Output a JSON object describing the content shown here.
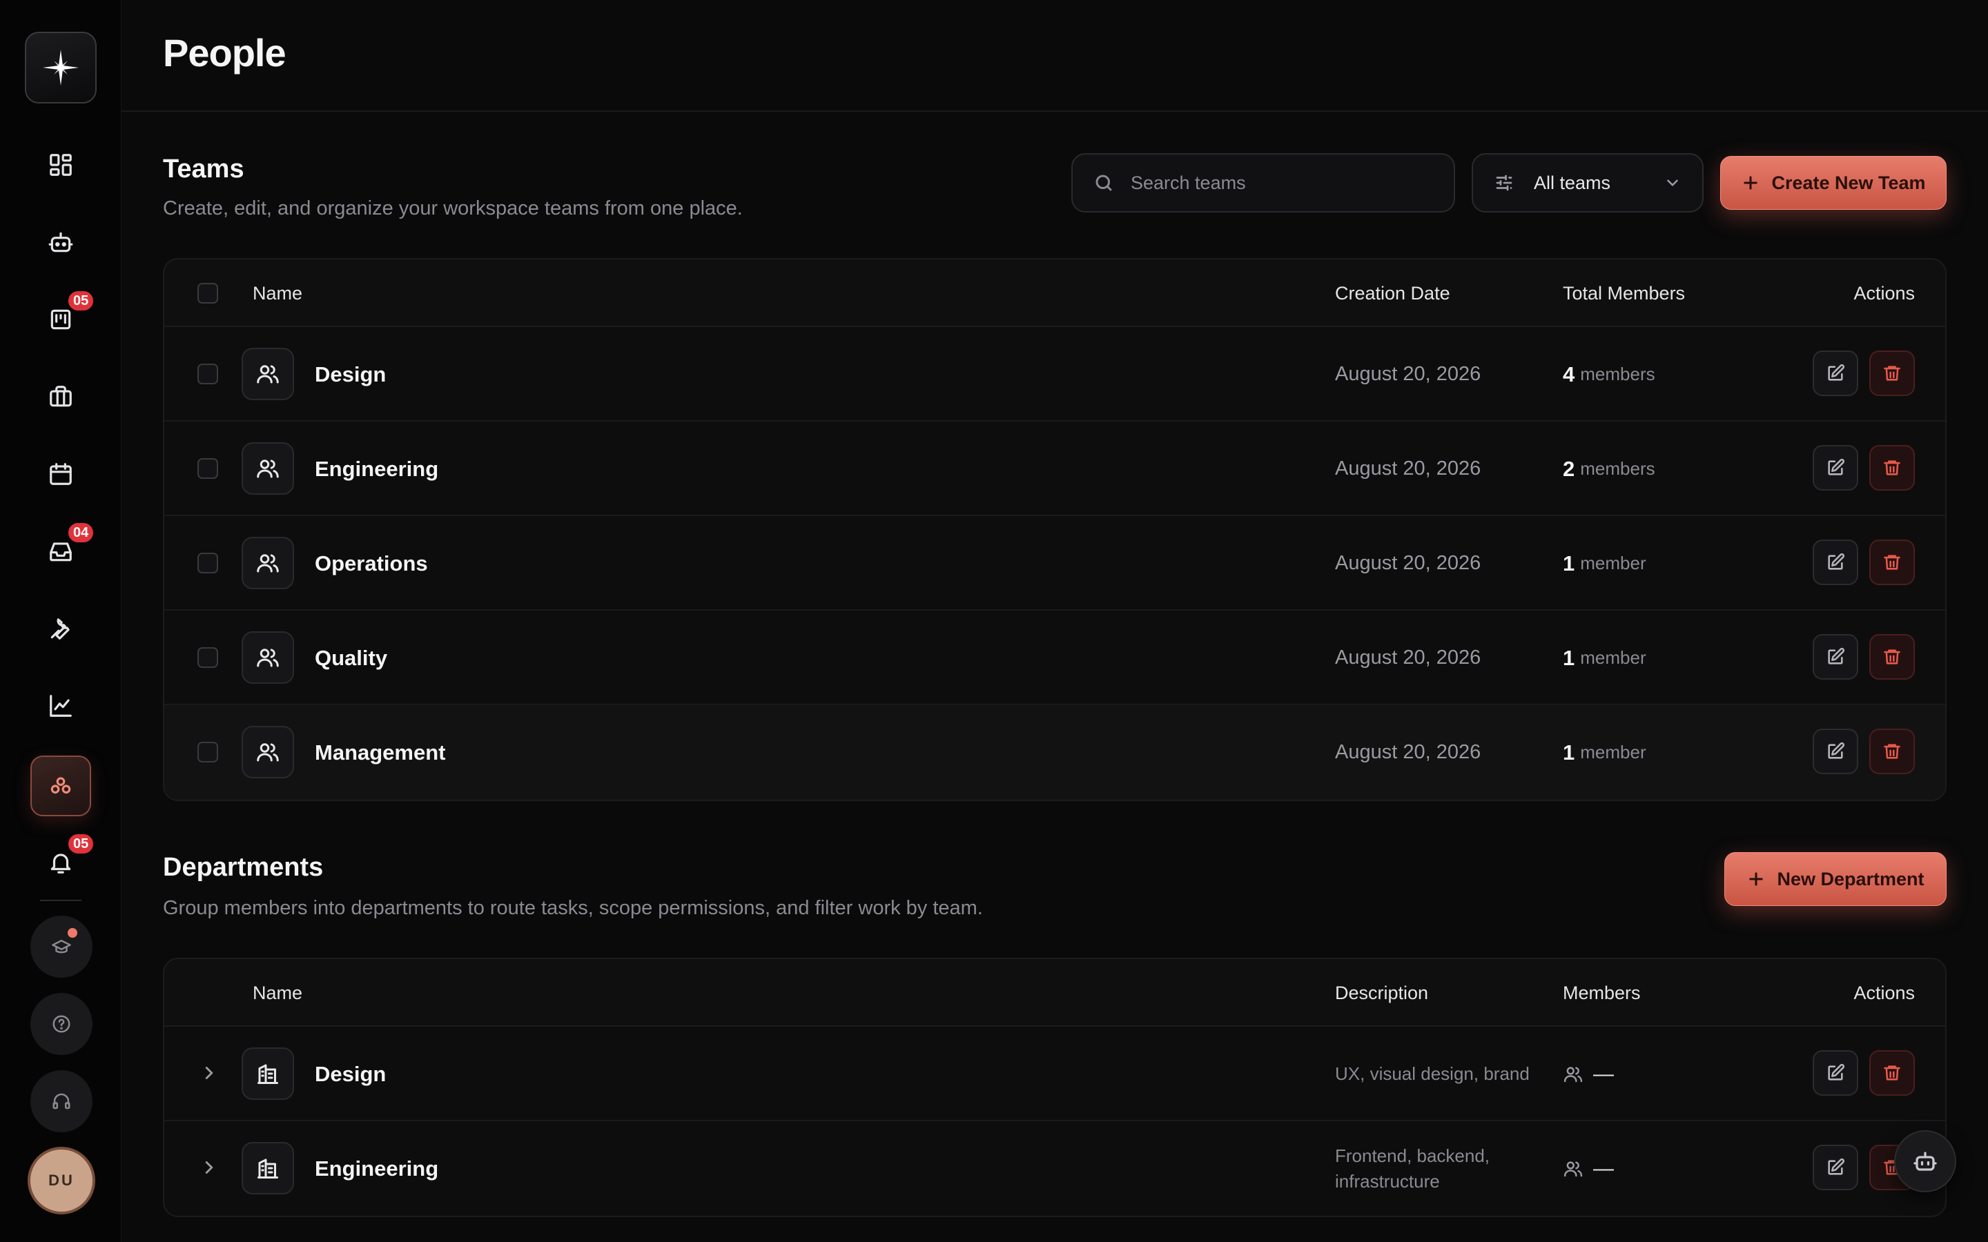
{
  "app": {
    "page_title": "People"
  },
  "sidebar": {
    "items": [
      {
        "icon": "dashboard-icon"
      },
      {
        "icon": "bot-icon"
      },
      {
        "icon": "board-icon",
        "badge": "05"
      },
      {
        "icon": "briefcase-icon"
      },
      {
        "icon": "calendar-icon"
      },
      {
        "icon": "inbox-icon",
        "badge": "04"
      },
      {
        "icon": "wrench-icon"
      },
      {
        "icon": "chart-icon"
      },
      {
        "icon": "people-icon",
        "active": true
      },
      {
        "icon": "bell-icon",
        "badge": "05"
      }
    ],
    "bottom": [
      {
        "icon": "graduation-cap-icon"
      },
      {
        "icon": "help-icon"
      },
      {
        "icon": "headset-icon"
      }
    ],
    "avatar_initials": "DU"
  },
  "teams": {
    "title": "Teams",
    "subtitle": "Create, edit, and organize your workspace teams from one place.",
    "search": {
      "placeholder": "Search teams"
    },
    "filter": {
      "selected": "All teams"
    },
    "create_button": "Create New Team",
    "columns": {
      "name": "Name",
      "date": "Creation Date",
      "members": "Total Members",
      "actions": "Actions"
    },
    "rows": [
      {
        "name": "Design",
        "date": "August 20, 2026",
        "count": "4",
        "unit": "members"
      },
      {
        "name": "Engineering",
        "date": "August 20, 2026",
        "count": "2",
        "unit": "members"
      },
      {
        "name": "Operations",
        "date": "August 20, 2026",
        "count": "1",
        "unit": "member"
      },
      {
        "name": "Quality",
        "date": "August 20, 2026",
        "count": "1",
        "unit": "member"
      },
      {
        "name": "Management",
        "date": "August 20, 2026",
        "count": "1",
        "unit": "member"
      }
    ]
  },
  "departments": {
    "title": "Departments",
    "subtitle": "Group members into departments to route tasks, scope permissions, and filter work by team.",
    "create_button": "New Department",
    "columns": {
      "name": "Name",
      "description": "Description",
      "members": "Members",
      "actions": "Actions"
    },
    "rows": [
      {
        "name": "Design",
        "description": "UX, visual design, brand",
        "members": "—"
      },
      {
        "name": "Engineering",
        "description": "Frontend, backend, infrastructure",
        "members": "—"
      }
    ]
  },
  "colors": {
    "accent": "#d9604f",
    "danger": "#e8584a",
    "badge": "#e0323a"
  }
}
